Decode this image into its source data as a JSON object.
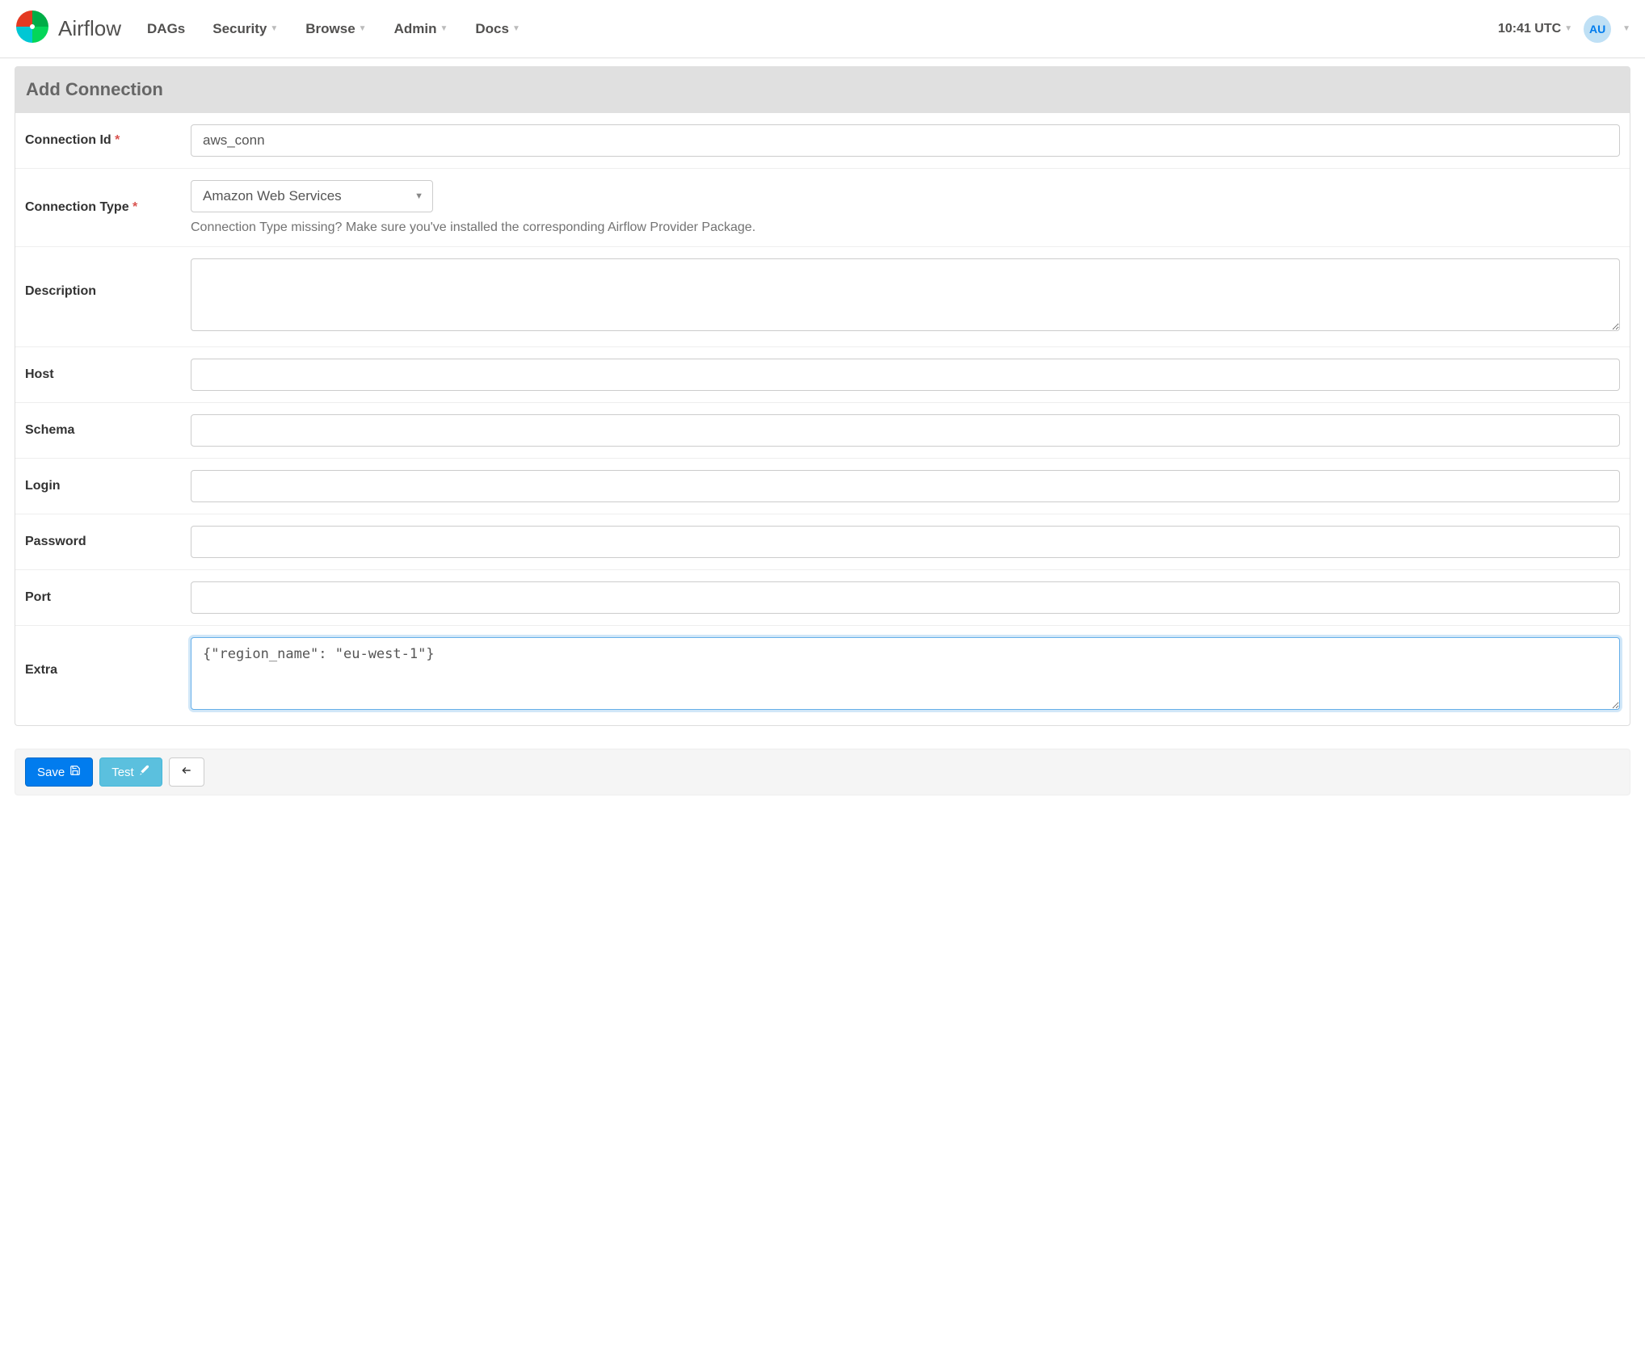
{
  "brand": {
    "name": "Airflow"
  },
  "nav": {
    "items": [
      {
        "label": "DAGs",
        "hasCaret": false
      },
      {
        "label": "Security",
        "hasCaret": true
      },
      {
        "label": "Browse",
        "hasCaret": true
      },
      {
        "label": "Admin",
        "hasCaret": true
      },
      {
        "label": "Docs",
        "hasCaret": true
      }
    ]
  },
  "clock": {
    "time": "10:41 UTC"
  },
  "user": {
    "initials": "AU"
  },
  "page_title": "Add Connection",
  "form": {
    "conn_id": {
      "label": "Connection Id",
      "required": true,
      "value": "aws_conn"
    },
    "conn_type": {
      "label": "Connection Type",
      "required": true,
      "selected": "Amazon Web Services",
      "help": "Connection Type missing? Make sure you've installed the corresponding Airflow Provider Package."
    },
    "description": {
      "label": "Description",
      "value": ""
    },
    "host": {
      "label": "Host",
      "value": ""
    },
    "schema": {
      "label": "Schema",
      "value": ""
    },
    "login": {
      "label": "Login",
      "value": ""
    },
    "password": {
      "label": "Password",
      "value": ""
    },
    "port": {
      "label": "Port",
      "value": ""
    },
    "extra": {
      "label": "Extra",
      "value": "{\"region_name\": \"eu-west-1\"}"
    }
  },
  "actions": {
    "save": "Save",
    "test": "Test",
    "back_title": "Back"
  }
}
